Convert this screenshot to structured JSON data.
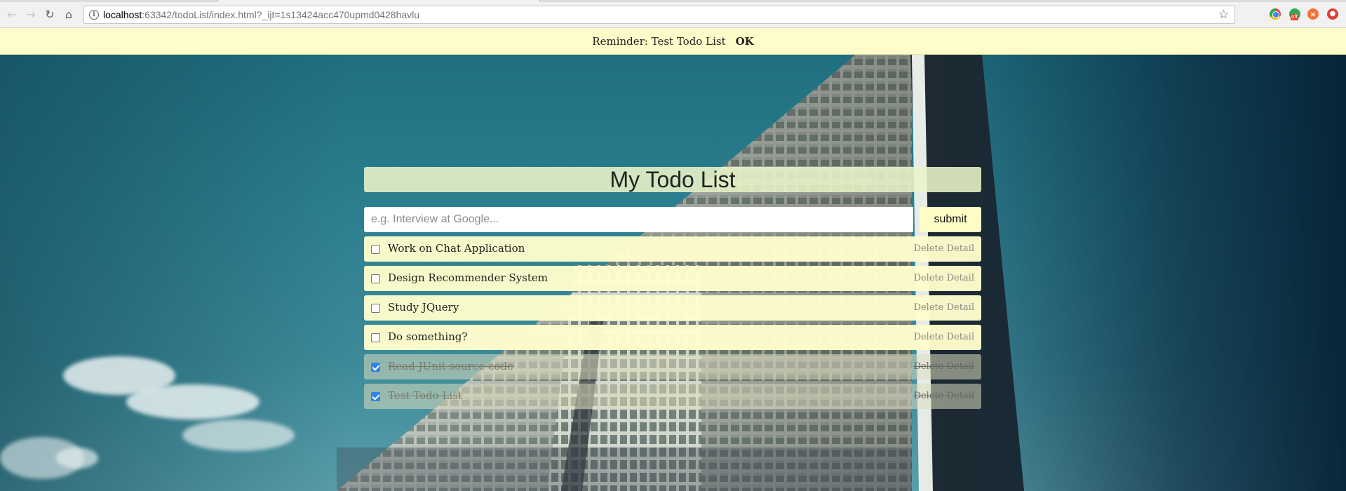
{
  "browser": {
    "url_host": "localhost",
    "url_rest": ":63342/todoList/index.html?_ijt=1s13424acc470upmd0428havlu"
  },
  "reminder": {
    "text": "Reminder: Test Todo List",
    "ok_label": "OK"
  },
  "app": {
    "title": "My Todo List",
    "input": {
      "placeholder": "e.g. Interview at Google...",
      "value": ""
    },
    "submit_label": "submit",
    "todos": [
      {
        "label": "Work on Chat Application",
        "delete_label": "Delete",
        "detail_label": "Detail",
        "done": false
      },
      {
        "label": "Design Recommender System",
        "delete_label": "Delete",
        "detail_label": "Detail",
        "done": false
      },
      {
        "label": "Study JQuery",
        "delete_label": "Delete",
        "detail_label": "Detail",
        "done": false
      },
      {
        "label": "Do something?",
        "delete_label": "Delete",
        "detail_label": "Detail",
        "done": false
      },
      {
        "label": "Read JUnit source code",
        "delete_label": "Delete",
        "detail_label": "Detail",
        "done": true
      },
      {
        "label": "Test Todo List",
        "delete_label": "Delete",
        "detail_label": "Detail",
        "done": true
      }
    ]
  },
  "colors": {
    "reminder_bg": "#fefcc9",
    "item_bg": "#fffdcc",
    "checkbox_checked": "#2f83e6"
  }
}
